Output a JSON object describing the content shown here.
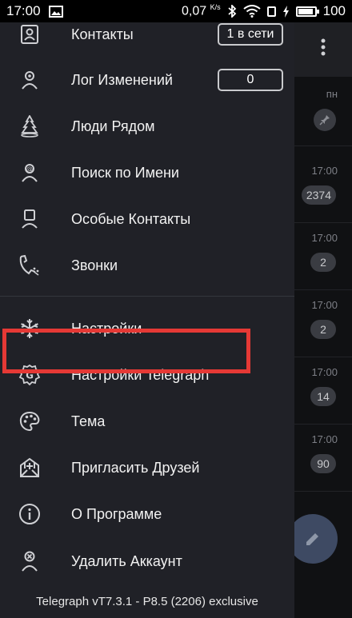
{
  "status_bar": {
    "time": "17:00",
    "net_speed": "0,07",
    "net_speed_unit": "K/s",
    "battery": "100",
    "battery_level": 1.0
  },
  "drawer": {
    "items": [
      {
        "label": "Контакты",
        "icon": "contacts-icon",
        "counter": "1 в сети"
      },
      {
        "label": "Лог Изменений",
        "icon": "changelog-icon",
        "counter": "0"
      },
      {
        "label": "Люди Рядом",
        "icon": "people-nearby-icon"
      },
      {
        "label": "Поиск по Имени",
        "icon": "search-by-username-icon"
      },
      {
        "label": "Особые Контакты",
        "icon": "special-contacts-icon"
      },
      {
        "label": "Звонки",
        "icon": "calls-icon"
      },
      {
        "label": "Настройки",
        "icon": "settings-snowflake-icon"
      },
      {
        "label": "Настройки Telegraph",
        "icon": "telegraph-settings-gear-icon"
      },
      {
        "label": "Тема",
        "icon": "palette-icon"
      },
      {
        "label": "Пригласить Друзей",
        "icon": "invite-envelope-icon"
      },
      {
        "label": "О Программе",
        "icon": "info-icon"
      },
      {
        "label": "Удалить Аккаунт",
        "icon": "delete-account-icon"
      }
    ],
    "footer": "Telegraph vT7.3.1 - P8.5 (2206) exclusive",
    "highlight_color": "#e53935"
  },
  "background_list": {
    "rows": [
      {
        "time": "пн",
        "badge": ""
      },
      {
        "time": "17:00",
        "badge": "2374"
      },
      {
        "time": "17:00",
        "badge": "2"
      },
      {
        "time": "17:00",
        "badge": "2"
      },
      {
        "time": "17:00",
        "badge": "14"
      },
      {
        "time": "17:00",
        "badge": "90"
      }
    ]
  }
}
